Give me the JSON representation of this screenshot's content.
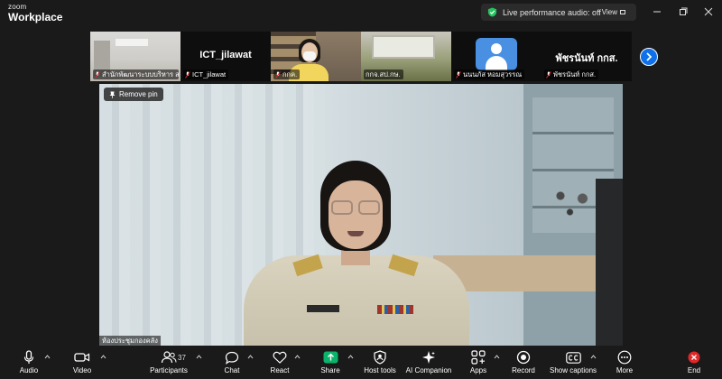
{
  "app": {
    "brand_top": "zoom",
    "brand_bottom": "Workplace"
  },
  "status": {
    "perf_text": "Live performance audio: off",
    "view_label": "View"
  },
  "thumbnails": [
    {
      "label": "สำนักพัฒนาระบบบริหาร ส...",
      "muted": true,
      "type": "video"
    },
    {
      "label": "ICT_jilawat",
      "display_name": "ICT_jilawat",
      "muted": true,
      "type": "name"
    },
    {
      "label": "กกค.",
      "muted": true,
      "type": "video"
    },
    {
      "label": "กกจ.สป.กษ.",
      "muted": false,
      "type": "video"
    },
    {
      "label": "นนนภัส หอมสุวรรณ",
      "muted": true,
      "type": "avatar"
    },
    {
      "label": "พัชรนันท์ กกส.",
      "display_name": "พัชรนันท์ กกส.",
      "muted": true,
      "type": "name"
    }
  ],
  "main": {
    "remove_pin": "Remove pin",
    "speaker_label": "ห้องประชุมกองคลัง"
  },
  "toolbar": {
    "audio": "Audio",
    "video": "Video",
    "participants": "Participants",
    "participant_count": "37",
    "chat": "Chat",
    "react": "React",
    "share": "Share",
    "host_tools": "Host tools",
    "ai_companion": "AI Companion",
    "apps": "Apps",
    "record": "Record",
    "captions": "Show captions",
    "more": "More",
    "end": "End"
  },
  "colors": {
    "background": "#1a1a1a",
    "accent_blue": "#0e71eb",
    "share_green": "#0bb36b",
    "end_red": "#e02828",
    "shield_green": "#22c55e"
  }
}
